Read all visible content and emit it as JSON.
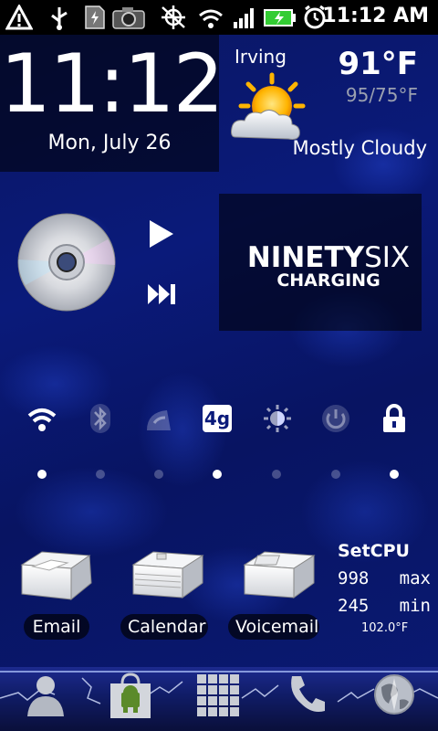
{
  "status_bar": {
    "time": "11:12 AM",
    "icons": [
      "warning-icon",
      "usb-icon",
      "sd-card-icon",
      "camera-icon",
      "gps-off-icon",
      "wifi-icon",
      "signal-icon",
      "battery-charging-icon",
      "alarm-icon"
    ]
  },
  "clock": {
    "time": "11:12",
    "date": "Mon, July 26"
  },
  "weather": {
    "city": "Irving",
    "temp": "91°F",
    "range": "95/75°F",
    "condition": "Mostly Cloudy"
  },
  "battery_widget": {
    "brand_bold": "NINETY",
    "brand_light": "SIX",
    "status": "CHARGING"
  },
  "power_controls": [
    {
      "name": "wifi",
      "on": true
    },
    {
      "name": "bluetooth",
      "on": false
    },
    {
      "name": "gps",
      "on": false
    },
    {
      "name": "4g",
      "label": "4g",
      "on": true
    },
    {
      "name": "brightness",
      "on": false
    },
    {
      "name": "power",
      "on": false
    },
    {
      "name": "lock",
      "on": true
    }
  ],
  "apps": [
    {
      "label": "Email"
    },
    {
      "label": "Calendar"
    },
    {
      "label": "Voicemail"
    }
  ],
  "setcpu": {
    "title": "SetCPU",
    "max_value": "998",
    "max_label": "max",
    "min_value": "245",
    "min_label": "min",
    "temperature": "102.0°F"
  },
  "dock": [
    "contacts-icon",
    "market-icon",
    "app-drawer-icon",
    "phone-icon",
    "browser-icon"
  ],
  "colors": {
    "background": "#0a1a7a",
    "panel": "#000000",
    "accent": "#8fb0ff"
  }
}
